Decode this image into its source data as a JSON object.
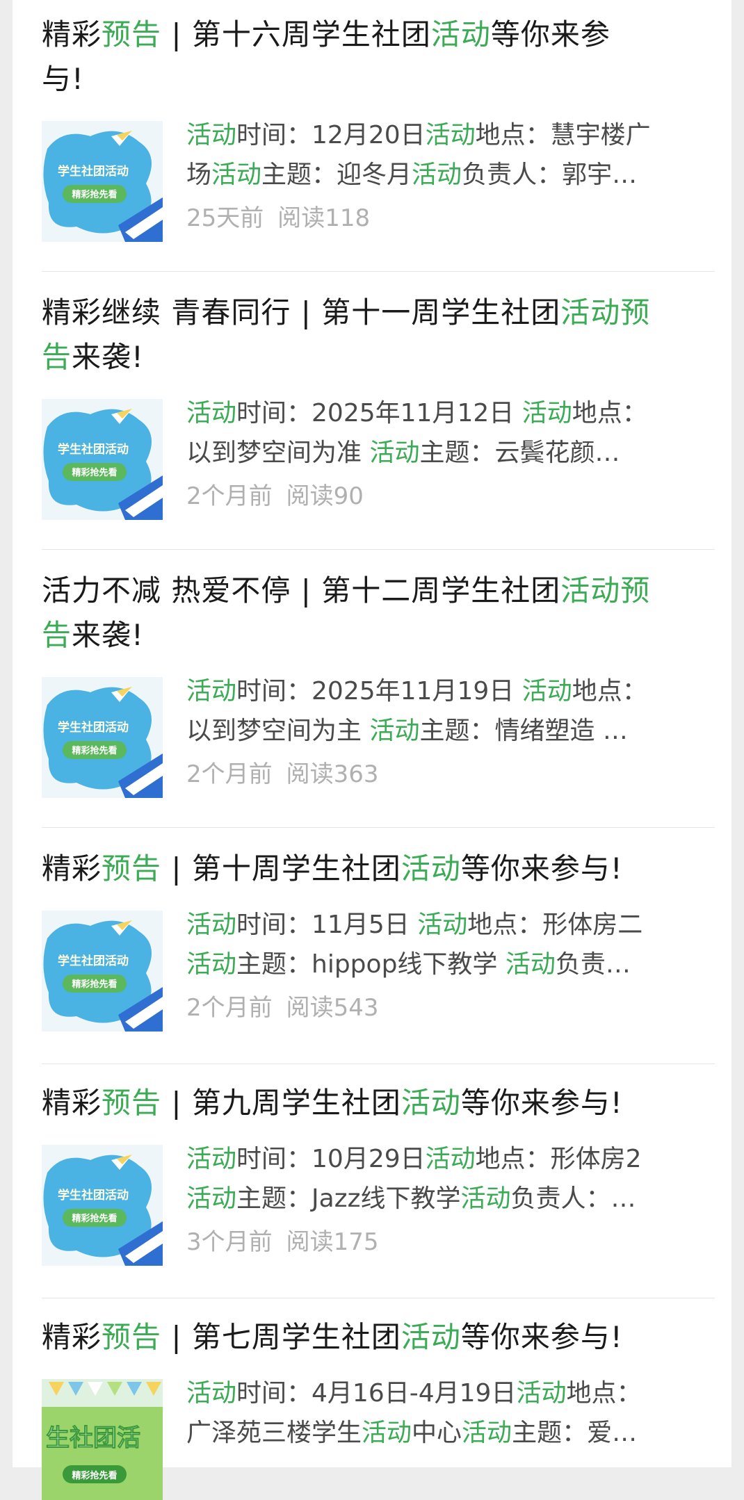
{
  "articles": [
    {
      "title": [
        {
          "t": "精彩",
          "hl": false
        },
        {
          "t": "预告",
          "hl": true
        },
        {
          "t": " | 第十六周学生社团",
          "hl": false
        },
        {
          "t": "活动",
          "hl": true
        },
        {
          "t": "等你来参",
          "hl": false
        },
        {
          "br": true
        },
        {
          "t": "与!",
          "hl": false
        }
      ],
      "summary": [
        [
          {
            "t": "活动",
            "hl": true
          },
          {
            "t": "时间：12月20日",
            "hl": false
          },
          {
            "t": "活动",
            "hl": true
          },
          {
            "t": "地点：慧宇楼广",
            "hl": false
          }
        ],
        [
          {
            "t": "场",
            "hl": false
          },
          {
            "t": "活动",
            "hl": true
          },
          {
            "t": "主题：迎冬月",
            "hl": false
          },
          {
            "t": "活动",
            "hl": true
          },
          {
            "t": "负责人：郭宇…",
            "hl": false
          }
        ]
      ],
      "time": "25天前",
      "reads": "阅读118",
      "thumb_text": [
        "学生社团活动",
        "精彩抢先看"
      ],
      "thumb_style": "blue"
    },
    {
      "title": [
        {
          "t": "精彩继续 青春同行 | 第十一周学生社团",
          "hl": false
        },
        {
          "t": "活动预",
          "hl": true
        },
        {
          "br": true
        },
        {
          "t": "告",
          "hl": true
        },
        {
          "t": "来袭!",
          "hl": false
        }
      ],
      "summary": [
        [
          {
            "t": "活动",
            "hl": true
          },
          {
            "t": "时间：2025年11月12日 ",
            "hl": false
          },
          {
            "t": "活动",
            "hl": true
          },
          {
            "t": "地点：",
            "hl": false
          }
        ],
        [
          {
            "t": "以到梦空间为准 ",
            "hl": false
          },
          {
            "t": "活动",
            "hl": true
          },
          {
            "t": "主题：云鬓花颜…",
            "hl": false
          }
        ]
      ],
      "time": "2个月前",
      "reads": "阅读90",
      "thumb_text": [
        "学生社团活动",
        "精彩抢先看"
      ],
      "thumb_style": "blue"
    },
    {
      "title": [
        {
          "t": "活力不减 热爱不停 | 第十二周学生社团",
          "hl": false
        },
        {
          "t": "活动预",
          "hl": true
        },
        {
          "br": true
        },
        {
          "t": "告",
          "hl": true
        },
        {
          "t": "来袭!",
          "hl": false
        }
      ],
      "summary": [
        [
          {
            "t": "活动",
            "hl": true
          },
          {
            "t": "时间：2025年11月19日 ",
            "hl": false
          },
          {
            "t": "活动",
            "hl": true
          },
          {
            "t": "地点：",
            "hl": false
          }
        ],
        [
          {
            "t": "以到梦空间为主 ",
            "hl": false
          },
          {
            "t": "活动",
            "hl": true
          },
          {
            "t": "主题：情绪塑造 …",
            "hl": false
          }
        ]
      ],
      "time": "2个月前",
      "reads": "阅读363",
      "thumb_text": [
        "学生社团活动",
        "精彩抢先看"
      ],
      "thumb_style": "blue"
    },
    {
      "title": [
        {
          "t": "精彩",
          "hl": false
        },
        {
          "t": "预告",
          "hl": true
        },
        {
          "t": " | 第十周学生社团",
          "hl": false
        },
        {
          "t": "活动",
          "hl": true
        },
        {
          "t": "等你来参与!",
          "hl": false
        }
      ],
      "summary": [
        [
          {
            "t": "活动",
            "hl": true
          },
          {
            "t": "时间：11月5日 ",
            "hl": false
          },
          {
            "t": "活动",
            "hl": true
          },
          {
            "t": "地点：形体房二",
            "hl": false
          }
        ],
        [
          {
            "t": "活动",
            "hl": true
          },
          {
            "t": "主题：hippop线下教学 ",
            "hl": false
          },
          {
            "t": "活动",
            "hl": true
          },
          {
            "t": "负责…",
            "hl": false
          }
        ]
      ],
      "time": "2个月前",
      "reads": "阅读543",
      "thumb_text": [
        "学生社团活动",
        "精彩抢先看"
      ],
      "thumb_style": "blue"
    },
    {
      "title": [
        {
          "t": "精彩",
          "hl": false
        },
        {
          "t": "预告",
          "hl": true
        },
        {
          "t": " | 第九周学生社团",
          "hl": false
        },
        {
          "t": "活动",
          "hl": true
        },
        {
          "t": "等你来参与!",
          "hl": false
        }
      ],
      "summary": [
        [
          {
            "t": "活动",
            "hl": true
          },
          {
            "t": "时间：10月29日",
            "hl": false
          },
          {
            "t": "活动",
            "hl": true
          },
          {
            "t": "地点：形体房2",
            "hl": false
          }
        ],
        [
          {
            "t": "活动",
            "hl": true
          },
          {
            "t": "主题：Jazz线下教学",
            "hl": false
          },
          {
            "t": "活动",
            "hl": true
          },
          {
            "t": "负责人：…",
            "hl": false
          }
        ]
      ],
      "time": "3个月前",
      "reads": "阅读175",
      "thumb_text": [
        "学生社团活动",
        "精彩抢先看"
      ],
      "thumb_style": "blue"
    },
    {
      "title": [
        {
          "t": "精彩",
          "hl": false
        },
        {
          "t": "预告",
          "hl": true
        },
        {
          "t": " | 第七周学生社团",
          "hl": false
        },
        {
          "t": "活动",
          "hl": true
        },
        {
          "t": "等你来参与!",
          "hl": false
        }
      ],
      "summary": [
        [
          {
            "t": "活动",
            "hl": true
          },
          {
            "t": "时间：4月16日-4月19日",
            "hl": false
          },
          {
            "t": "活动",
            "hl": true
          },
          {
            "t": "地点：",
            "hl": false
          }
        ],
        [
          {
            "t": "广泽苑三楼学生",
            "hl": false
          },
          {
            "t": "活动",
            "hl": true
          },
          {
            "t": "中心",
            "hl": false
          },
          {
            "t": "活动",
            "hl": true
          },
          {
            "t": "主题：爱…",
            "hl": false
          }
        ]
      ],
      "time": "",
      "reads": "",
      "thumb_text": [
        "生社团活",
        "精彩抢先看"
      ],
      "thumb_style": "green"
    }
  ],
  "colors": {
    "highlight": "#3bab55",
    "text": "#1a1a1a",
    "meta": "#b0b0b0",
    "background": "#ededed"
  }
}
